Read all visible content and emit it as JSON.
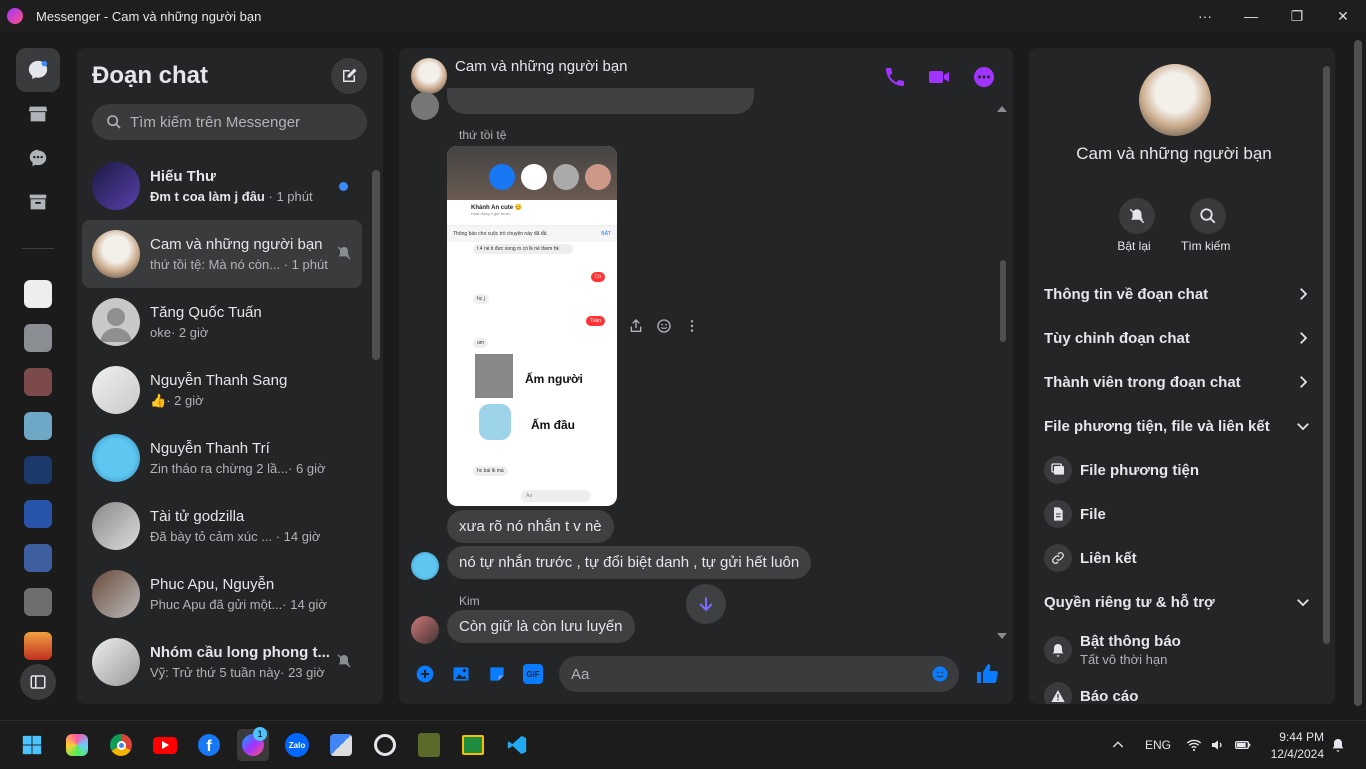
{
  "window": {
    "title": "Messenger - Cam và những người bạn"
  },
  "sidebar_list": {
    "heading": "Đoạn chat",
    "search_placeholder": "Tìm kiếm trên Messenger",
    "conversations": [
      {
        "name": "Hiếu Thư",
        "preview": "Đm t coa làm j đâu",
        "time": "· 1 phút",
        "unread": true
      },
      {
        "name": "Cam và những người bạn",
        "preview": "thứ tồi tệ: Mà nó còn...",
        "time": "· 1 phút",
        "muted": true,
        "selected": true
      },
      {
        "name": "Tăng Quốc Tuấn",
        "preview": "oke",
        "time": "· 2 giờ"
      },
      {
        "name": "Nguyễn Thanh Sang",
        "preview": "👍",
        "time": "· 2 giờ"
      },
      {
        "name": "Nguyễn Thanh Trí",
        "preview": "Zin tháo ra chừng 2 lầ...",
        "time": "· 6 giờ"
      },
      {
        "name": "Tài tử godzilla",
        "preview": "Đã bày tỏ cảm xúc ...",
        "time": "· 14 giờ"
      },
      {
        "name": "Phuc Apu, Nguyễn",
        "preview": "Phuc Apu đã gửi một...",
        "time": "· 14 giờ"
      },
      {
        "name": "Nhóm cầu long phong t...",
        "preview": "Vỹ: Trử thứ 5 tuần này",
        "time": "· 23 giờ",
        "muted": true
      }
    ]
  },
  "chat": {
    "title": "Cam và những người bạn",
    "sender_1": "thứ tồi tệ",
    "sender_2": "Kim",
    "messages": [
      {
        "text": "xưa rõ nó nhắn t v nè"
      },
      {
        "text": "nó tự nhắn trước , tự đổi biệt danh , tự gửi hết luôn"
      },
      {
        "text": "Còn giữ là còn lưu luyến"
      }
    ],
    "screenshot": {
      "contact": "Khánh An cute 😊",
      "status": "Hoạt động 9 giờ trước",
      "notice": "Thông báo cho cuộc trò chuyện này đã tắt.",
      "notice_action": "BẬT",
      "lines": [
        "t 4 nè ti đưc xong m có lk nè them hk",
        "Có",
        "hc j",
        "Toàn",
        "um",
        "Ấm người",
        "Ấm đầu",
        "hc bai lk má"
      ],
      "input": "Aa"
    },
    "composer_placeholder": "Aa"
  },
  "info": {
    "name": "Cam và những người bạn",
    "mute_label": "Bật lại",
    "search_label": "Tìm kiếm",
    "rows": [
      "Thông tin về đoạn chat",
      "Tùy chỉnh đoạn chat",
      "Thành viên trong đoạn chat",
      "File phương tiện, file và liên kết"
    ],
    "media_items": [
      "File phương tiện",
      "File",
      "Liên kết"
    ],
    "privacy": "Quyền riêng tư & hỗ trợ",
    "notif_title": "Bật thông báo",
    "notif_sub": "Tất vô thời hạn",
    "report": "Báo cáo"
  },
  "taskbar": {
    "lang": "ENG",
    "time": "9:44 PM",
    "date": "12/4/2024",
    "messenger_badge": "1"
  },
  "colors": {
    "accent": "#a033ff",
    "bg": "#242526",
    "bubble": "#3e4042"
  }
}
